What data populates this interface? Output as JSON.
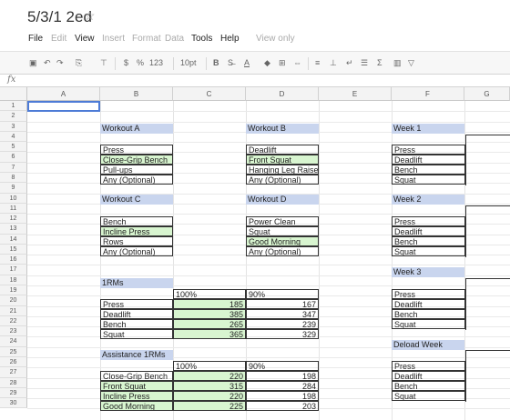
{
  "title": "5/3/1 2ed",
  "menu": {
    "file": "File",
    "edit": "Edit",
    "view": "View",
    "insert": "Insert",
    "format": "Format",
    "data": "Data",
    "tools": "Tools",
    "help": "Help",
    "mode": "View only"
  },
  "toolbar": {
    "currency": "$",
    "percent": "%",
    "number_format": "123",
    "font_size": "10pt",
    "bold": "B"
  },
  "formula_bar": {
    "fx": "fx"
  },
  "columns": [
    "A",
    "B",
    "C",
    "D",
    "E",
    "F",
    "G"
  ],
  "rows": [
    "1",
    "2",
    "3",
    "4",
    "5",
    "6",
    "7",
    "8",
    "9",
    "10",
    "11",
    "12",
    "13",
    "14",
    "15",
    "16",
    "17",
    "18",
    "19",
    "20",
    "21",
    "22",
    "23",
    "24",
    "25",
    "26",
    "27",
    "28",
    "29",
    "30"
  ],
  "workouts": {
    "a": {
      "title": "Workout A",
      "lifts": [
        "Press",
        "Close-Grip Bench",
        "Pull-ups",
        "Any (Optional)"
      ]
    },
    "b": {
      "title": "Workout B",
      "lifts": [
        "Deadlift",
        "Front Squat",
        "Hanging Leg Raise",
        "Any (Optional)"
      ]
    },
    "c": {
      "title": "Workout C",
      "lifts": [
        "Bench",
        "Incline Press",
        "Rows",
        "Any (Optional)"
      ]
    },
    "d": {
      "title": "Workout D",
      "lifts": [
        "Power Clean",
        "Squat",
        "Good Morning",
        "Any (Optional)"
      ]
    }
  },
  "rms": {
    "title": "1RMs",
    "col_100": "100%",
    "col_90": "90%",
    "rows": [
      {
        "lift": "Press",
        "full": "185",
        "ninety": "167"
      },
      {
        "lift": "Deadlift",
        "full": "385",
        "ninety": "347"
      },
      {
        "lift": "Bench",
        "full": "265",
        "ninety": "239"
      },
      {
        "lift": "Squat",
        "full": "365",
        "ninety": "329"
      }
    ]
  },
  "assistance": {
    "title": "Assistance 1RMs",
    "col_100": "100%",
    "col_90": "90%",
    "rows": [
      {
        "lift": "Close-Grip Bench",
        "full": "220",
        "ninety": "198"
      },
      {
        "lift": "Front Squat",
        "full": "315",
        "ninety": "284"
      },
      {
        "lift": "Incline Press",
        "full": "220",
        "ninety": "198"
      },
      {
        "lift": "Good Morning",
        "full": "225",
        "ninety": "203"
      }
    ]
  },
  "weeks": [
    {
      "title": "Week 1",
      "lifts": [
        "Press",
        "Deadlift",
        "Bench",
        "Squat"
      ]
    },
    {
      "title": "Week 2",
      "lifts": [
        "Press",
        "Deadlift",
        "Bench",
        "Squat"
      ]
    },
    {
      "title": "Week 3",
      "lifts": [
        "Press",
        "Deadlift",
        "Bench",
        "Squat"
      ]
    },
    {
      "title": "Deload Week",
      "lifts": [
        "Press",
        "Deadlift",
        "Bench",
        "Squat"
      ]
    }
  ]
}
